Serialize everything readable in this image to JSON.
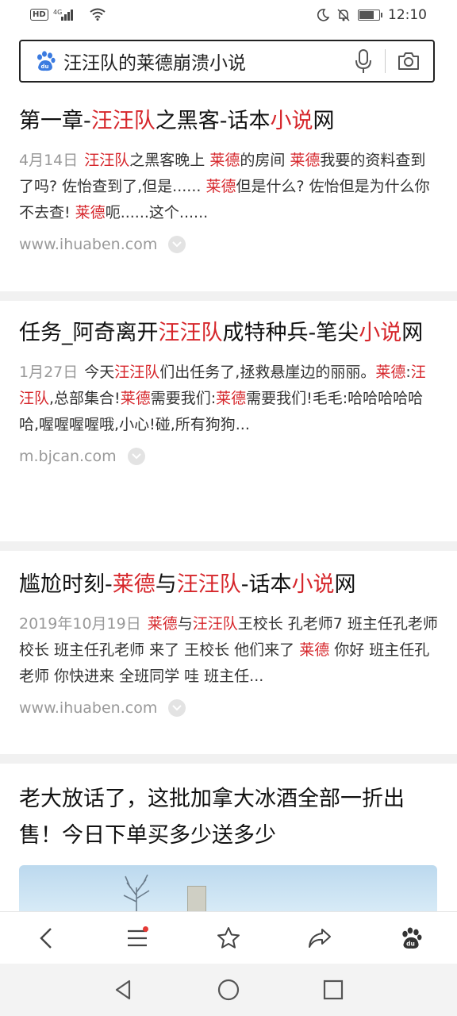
{
  "status_bar": {
    "network": "HD",
    "signal": "4G",
    "time": "12:10",
    "battery_level": 0.8
  },
  "search": {
    "query": "汪汪队的莱德崩溃小说"
  },
  "results": [
    {
      "title": [
        [
          "第一章-",
          0
        ],
        [
          "汪汪队",
          1
        ],
        [
          "之黑客-话本",
          0
        ],
        [
          "小说",
          1
        ],
        [
          "网",
          0
        ]
      ],
      "date": "4月14日",
      "snippet": [
        [
          "汪汪队",
          1
        ],
        [
          "之黑客晚上 ",
          0
        ],
        [
          "莱德",
          1
        ],
        [
          "的房间 ",
          0
        ],
        [
          "莱德",
          1
        ],
        [
          "我要的资料查到了吗? 佐怡查到了,但是...... ",
          0
        ],
        [
          "莱德",
          1
        ],
        [
          "但是什么? 佐怡但是为什么你不去查! ",
          0
        ],
        [
          "莱德",
          1
        ],
        [
          "呃......这个......",
          0
        ]
      ],
      "source": "www.ihuaben.com"
    },
    {
      "title": [
        [
          "任务_阿奇离开",
          0
        ],
        [
          "汪汪队",
          1
        ],
        [
          "成特种兵-笔尖",
          0
        ],
        [
          "小说",
          1
        ],
        [
          "网",
          0
        ]
      ],
      "date": "1月27日",
      "snippet": [
        [
          "今天",
          0
        ],
        [
          "汪汪队",
          1
        ],
        [
          "们出任务了,拯救悬崖边的丽丽。",
          0
        ],
        [
          "莱德",
          1
        ],
        [
          ":",
          0
        ],
        [
          "汪汪队",
          1
        ],
        [
          ",总部集合!",
          0
        ],
        [
          "莱德",
          1
        ],
        [
          "需要我们:",
          0
        ],
        [
          "莱德",
          1
        ],
        [
          "需要我们!毛毛:哈哈哈哈哈哈,喔喔喔喔哦,小心!碰,所有狗狗...",
          0
        ]
      ],
      "source": "m.bjcan.com"
    },
    {
      "title": [
        [
          "尴尬时刻-",
          0
        ],
        [
          "莱德",
          1
        ],
        [
          "与",
          0
        ],
        [
          "汪汪队",
          1
        ],
        [
          "-话本",
          0
        ],
        [
          "小说",
          1
        ],
        [
          "网",
          0
        ]
      ],
      "date": "2019年10月19日",
      "snippet": [
        [
          "莱德",
          1
        ],
        [
          "与",
          0
        ],
        [
          "汪汪队",
          1
        ],
        [
          "王校长 孔老师7 班主任孔老师 校长 班主任孔老师 来了 王校长 他们来了 ",
          0
        ],
        [
          "莱德",
          1
        ],
        [
          " 你好 班主任孔老师 你快进来 全班同学 哇 班主任...",
          0
        ]
      ],
      "source": "www.ihuaben.com"
    },
    {
      "title": [
        [
          "老大放话了，这批加拿大冰酒全部一折出售！今日下单买多少送多少",
          0
        ]
      ]
    }
  ],
  "toolbar": {
    "items": [
      "back-icon",
      "menu-icon",
      "favorite-icon",
      "share-icon",
      "baidu-home-icon"
    ],
    "menu_has_badge": true
  },
  "navbar": {
    "items": [
      "nav-back-icon",
      "nav-home-icon",
      "nav-recents-icon"
    ]
  },
  "colors": {
    "highlight": "#d6262b",
    "meta": "#999999",
    "separator": "#f1f1f1"
  }
}
